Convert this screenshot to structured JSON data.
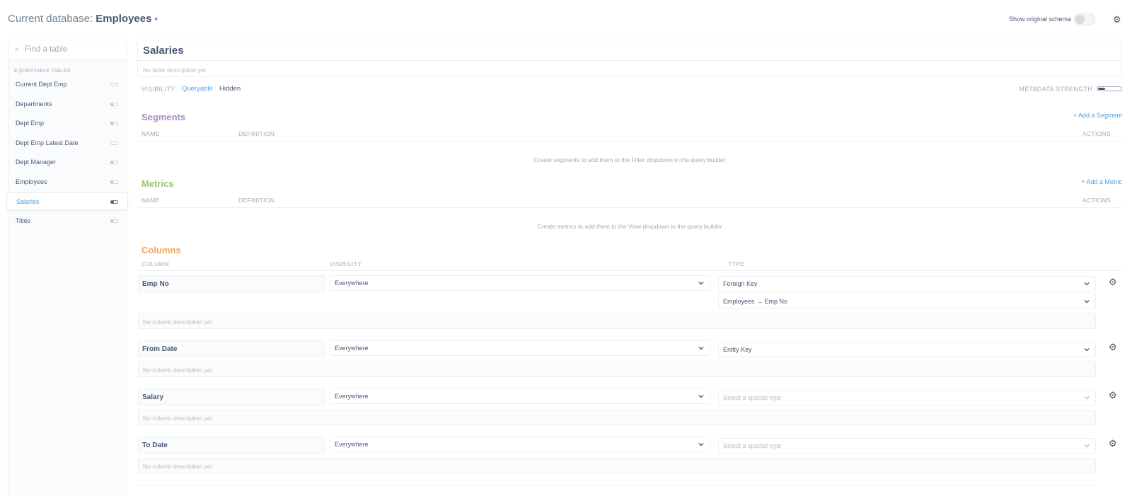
{
  "header": {
    "db_prefix": "Current database: ",
    "db_name": "Employees",
    "show_original_schema": "Show original schema"
  },
  "sidebar": {
    "search_placeholder": "Find a table",
    "queryable_label": "8 QUERYABLE TABLES",
    "tables": [
      {
        "name": "Current Dept Emp",
        "strength": 0.0
      },
      {
        "name": "Departments",
        "strength": 0.3
      },
      {
        "name": "Dept Emp",
        "strength": 0.3
      },
      {
        "name": "Dept Emp Latest Date",
        "strength": 0.0
      },
      {
        "name": "Dept Manager",
        "strength": 0.3
      },
      {
        "name": "Employees",
        "strength": 0.3
      },
      {
        "name": "Salaries",
        "strength": 0.4,
        "active": true
      },
      {
        "name": "Titles",
        "strength": 0.3
      }
    ]
  },
  "table": {
    "title": "Salaries",
    "description_placeholder": "No table description yet",
    "visibility_label": "VISIBILITY",
    "visibility_queryable": "Queryable",
    "visibility_hidden": "Hidden",
    "metadata_strength_label": "METADATA STRENGTH",
    "metadata_strength": 0.3
  },
  "segments": {
    "title": "Segments",
    "add_label": "+ Add a Segment",
    "col_name": "NAME",
    "col_definition": "DEFINITION",
    "col_actions": "ACTIONS",
    "empty": "Create segments to add them to the Filter dropdown in the query builder"
  },
  "metrics": {
    "title": "Metrics",
    "add_label": "+ Add a Metric",
    "col_name": "NAME",
    "col_definition": "DEFINITION",
    "col_actions": "ACTIONS",
    "empty": "Create metrics to add them to the View dropdown in the query builder"
  },
  "columns": {
    "title": "Columns",
    "col_column": "COLUMN",
    "col_visibility": "VISIBILITY",
    "col_type": "TYPE",
    "rows": [
      {
        "name": "Emp No",
        "visibility": "Everywhere",
        "type": "Foreign Key",
        "target": "Employees → Emp No",
        "description_placeholder": "No column description yet"
      },
      {
        "name": "From Date",
        "visibility": "Everywhere",
        "type": "Entity Key",
        "description_placeholder": "No column description yet"
      },
      {
        "name": "Salary",
        "visibility": "Everywhere",
        "type_placeholder": "Select a special type",
        "description_placeholder": "No column description yet"
      },
      {
        "name": "To Date",
        "visibility": "Everywhere",
        "type_placeholder": "Select a special type",
        "description_placeholder": "No column description yet"
      }
    ]
  },
  "colors": {
    "segments": "#a989c5",
    "metrics": "#9cc177",
    "columns": "#f9a354",
    "link": "#509ee3"
  }
}
